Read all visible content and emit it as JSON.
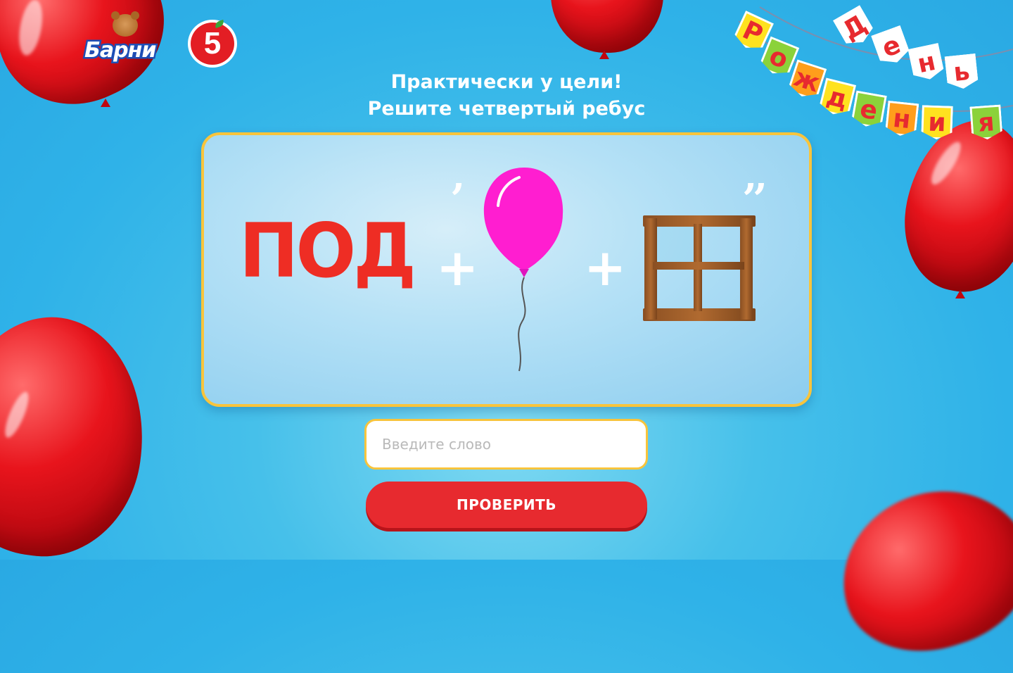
{
  "brand": {
    "barni_logo_text": "Барни",
    "pyaterochka_logo_text": "5"
  },
  "garland": {
    "line1": [
      "Д",
      "е",
      "н",
      "ь"
    ],
    "line2": [
      "Р",
      "о",
      "ж",
      "д",
      "е",
      "н",
      "и",
      "я"
    ],
    "flag_colors": [
      "#ffffff",
      "#ffe21f",
      "#8bd23a",
      "#ff9e1b"
    ]
  },
  "headline": {
    "line1": "Практически у цели!",
    "line2": "Решите четвертый ребус"
  },
  "rebus": {
    "word": "ПОД",
    "plus": "+",
    "comma_single": "’",
    "comma_double": "’’",
    "balloon_color": "#ff1ed0"
  },
  "form": {
    "input_placeholder": "Введите слово",
    "input_value": "",
    "submit_label": "ПРОВЕРИТЬ"
  }
}
